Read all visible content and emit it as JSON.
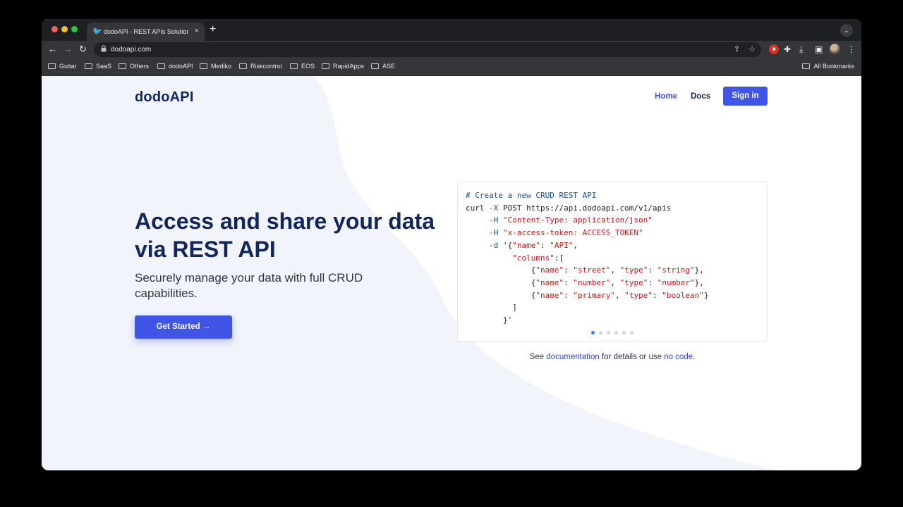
{
  "browser": {
    "tab": {
      "title": "dodoAPI - REST APIs Solution",
      "close_label": "×",
      "favicon": "dodo-favicon"
    },
    "new_tab_label": "+",
    "tab_menu_label": "⌄",
    "toolbar": {
      "back": "←",
      "forward": "→",
      "reload": "↻",
      "lock_icon": "🔒",
      "url": "dodoapi.com",
      "share": "⇪",
      "star": "☆",
      "ext_red": "■",
      "puzzle": "✚",
      "download": "⤓",
      "sidepanel": "▣",
      "kebab": "⋮"
    },
    "bookmarks": [
      "Guitar",
      "SaaS",
      "Others",
      "dodoAPI",
      "Mediko",
      "Riskcontrol",
      "EOS",
      "RapidApps",
      "ASE"
    ],
    "all_bookmarks": "All Bookmarks"
  },
  "page": {
    "brand": "dodoAPI",
    "nav": {
      "home": "Home",
      "docs": "Docs",
      "signin": "Sign in"
    },
    "hero": {
      "title_line1": "Access and share your data",
      "title_line2": "via REST API",
      "subtitle": "Securely manage your data with full CRUD capabilities.",
      "cta": "Get Started →"
    },
    "code": {
      "comment": "# Create a new CRUD REST API",
      "curl": "curl",
      "flag_x": "-X",
      "method_url": " POST https://api.dodoapi.com/v1/apis",
      "flag_h": "-H",
      "header1": "\"Content-Type: application/json\"",
      "header2": "\"x-access-token: ACCESS_TOKEN\"",
      "flag_d": "-d",
      "body_open": "'{",
      "key_name": "\"name\"",
      "val_api": "\"API\"",
      "key_columns": "\"columns\"",
      "key_type": "\"type\"",
      "val_street": "\"street\"",
      "val_string": "\"string\"",
      "val_number": "\"number\"",
      "val_primary": "\"primary\"",
      "val_boolean": "\"boolean\"",
      "body_close": "}'"
    },
    "carousel": {
      "count": 6,
      "active_index": 0
    },
    "doc_note": {
      "prefix": "See ",
      "link1": "documentation",
      "middle": " for details or use ",
      "link2": "no code",
      "suffix": "."
    }
  },
  "colors": {
    "brand_navy": "#12265b",
    "primary": "#4154e8",
    "code_keyword": "#1a4d96",
    "code_string": "#c41a16",
    "bg_wave": "#f1f4fb"
  }
}
